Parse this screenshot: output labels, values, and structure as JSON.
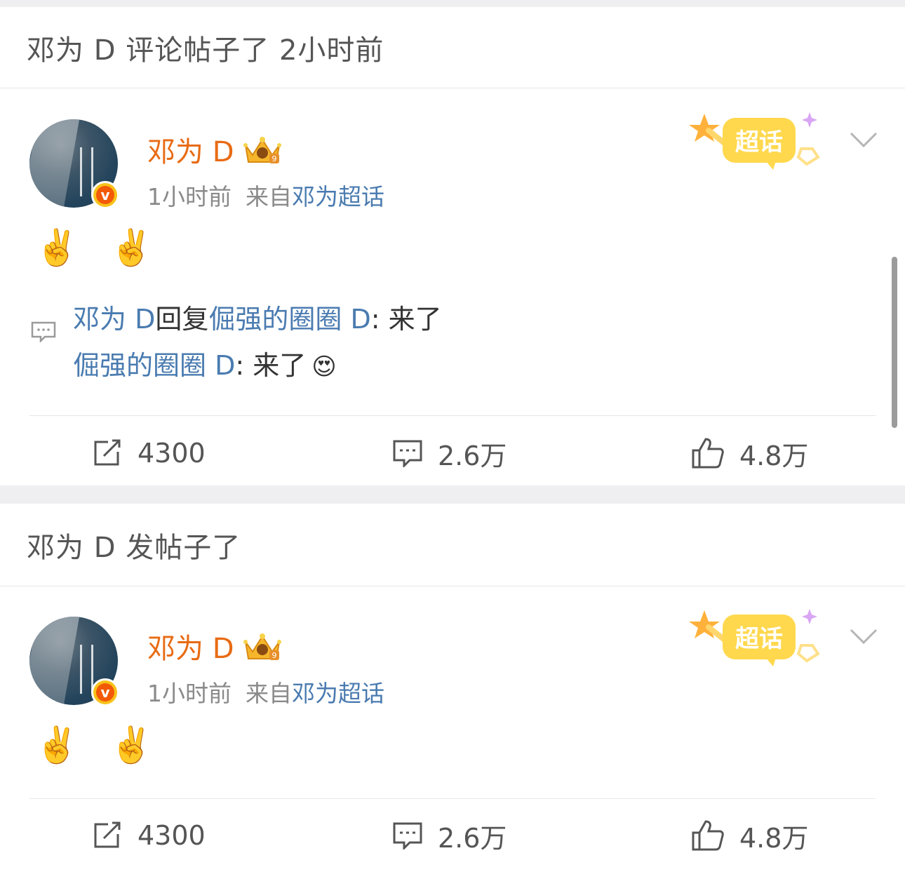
{
  "sections": [
    {
      "header": "邓为 D 评论帖子了 2小时前",
      "post": {
        "username": "邓为 D",
        "time": "1小时前",
        "from_prefix": "来自",
        "from_link": "邓为超话",
        "badge_letter": "v",
        "crown_level": "9",
        "chaohua_label": "超话",
        "content_emoji": "✌️ ✌️",
        "comment": {
          "line1_user": "邓为 D",
          "line1_reply": "回复",
          "line1_target": "倔强的圈圈 D",
          "line1_text": ": 来了",
          "line2_user": "倔强的圈圈 D",
          "line2_text": ": 来了",
          "line2_emoji": "😍"
        },
        "actions": {
          "repost": "4300",
          "comments": "2.6万",
          "likes": "4.8万"
        }
      }
    },
    {
      "header": "邓为 D 发帖子了",
      "post": {
        "username": "邓为 D",
        "time": "1小时前",
        "from_prefix": "来自",
        "from_link": "邓为超话",
        "badge_letter": "v",
        "crown_level": "9",
        "chaohua_label": "超话",
        "content_emoji": "✌️ ✌️",
        "actions": {
          "repost": "4300",
          "comments": "2.6万",
          "likes": "4.8万"
        }
      }
    }
  ],
  "colors": {
    "username": "#e86b14",
    "link": "#4a7bb0",
    "meta": "#8a8a8a",
    "badge_outer": "#f8c21a",
    "badge_inner": "#f25a08"
  },
  "icons": [
    "repost-icon",
    "comment-icon",
    "like-icon",
    "chevron-down-icon",
    "crown-icon",
    "chaohua-icon",
    "verified-badge-icon"
  ]
}
